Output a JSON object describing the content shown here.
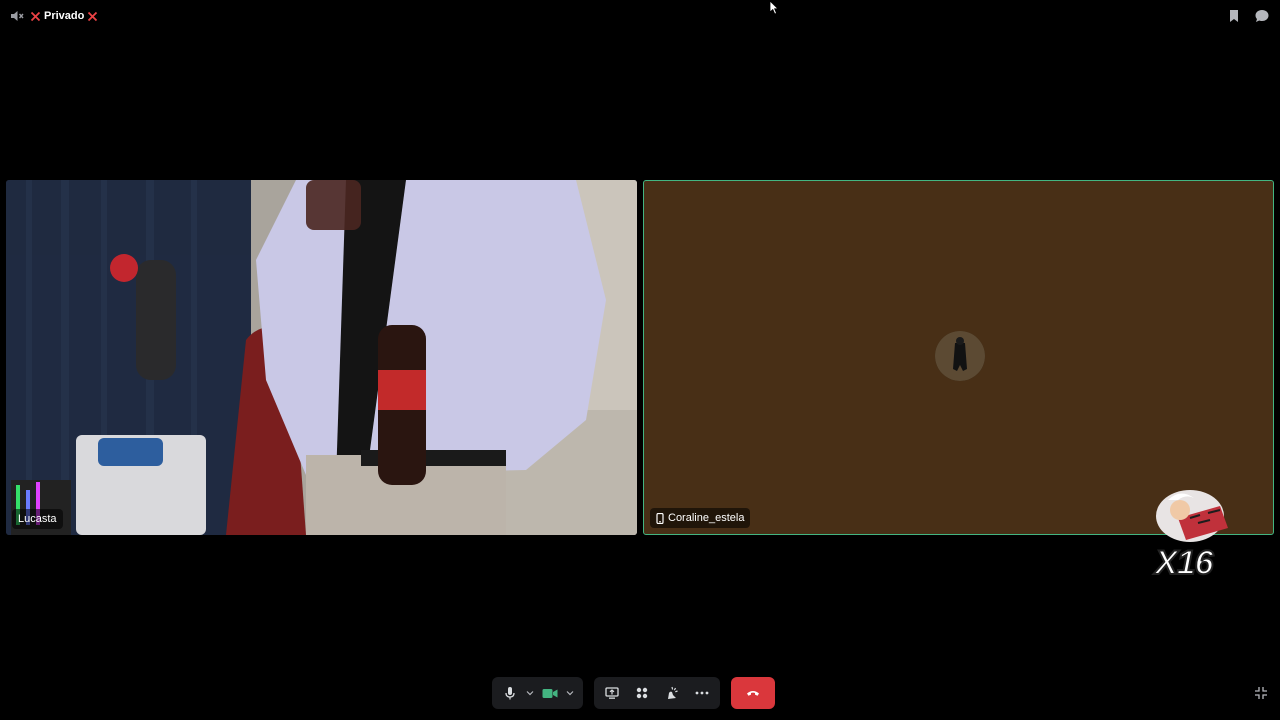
{
  "channel": {
    "name": "Privado"
  },
  "participants": [
    {
      "name": "Lucasta"
    },
    {
      "name": "Coraline_estela"
    }
  ],
  "sticker": {
    "count": "X16"
  },
  "colors": {
    "background": "#000000",
    "speaking_border": "#43b581",
    "hangup": "#da373c",
    "camera_on": "#43b581",
    "muted_x": "#ed4245"
  },
  "icons": {
    "top_left": [
      "speaker-muted-icon",
      "x-icon"
    ],
    "top_right": [
      "bookmark-icon",
      "chat-bubble-icon"
    ],
    "controls": [
      "microphone-icon",
      "chevron-down-icon",
      "camera-icon",
      "chevron-down-icon",
      "screen-share-icon",
      "activities-icon",
      "soundboard-icon",
      "more-icon",
      "hangup-icon"
    ],
    "bottom_right": "fullscreen-exit-icon"
  }
}
